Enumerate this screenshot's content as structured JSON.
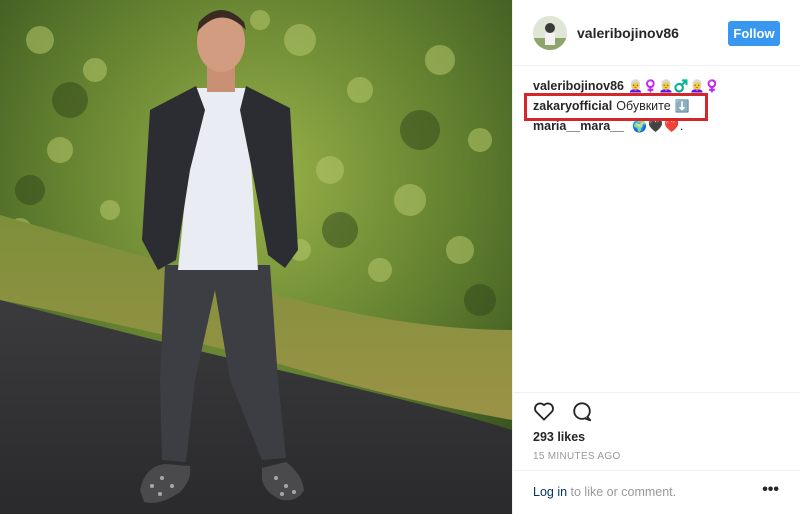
{
  "post": {
    "username": "valeribojinov86",
    "follow_label": "Follow",
    "likes": "293 likes",
    "timestamp": "15 MINUTES AGO",
    "footer": {
      "login_label": "Log in",
      "rest": " to like or comment.",
      "more_label": "•••"
    }
  },
  "comments": [
    {
      "user": "valeribojinov86",
      "text": "",
      "emoji_count": 6
    },
    {
      "user": "zakaryofficial",
      "text": "Обувките",
      "emoji_count": 1
    },
    {
      "user": "maria__mara__",
      "text": "",
      "emoji_count": 3
    }
  ],
  "icons": {
    "like": "heart-outline-icon",
    "comment": "speech-bubble-icon"
  },
  "colors": {
    "follow_bg": "#3897f0",
    "highlight": "#d7252c",
    "link": "#003569",
    "muted": "#999999"
  }
}
